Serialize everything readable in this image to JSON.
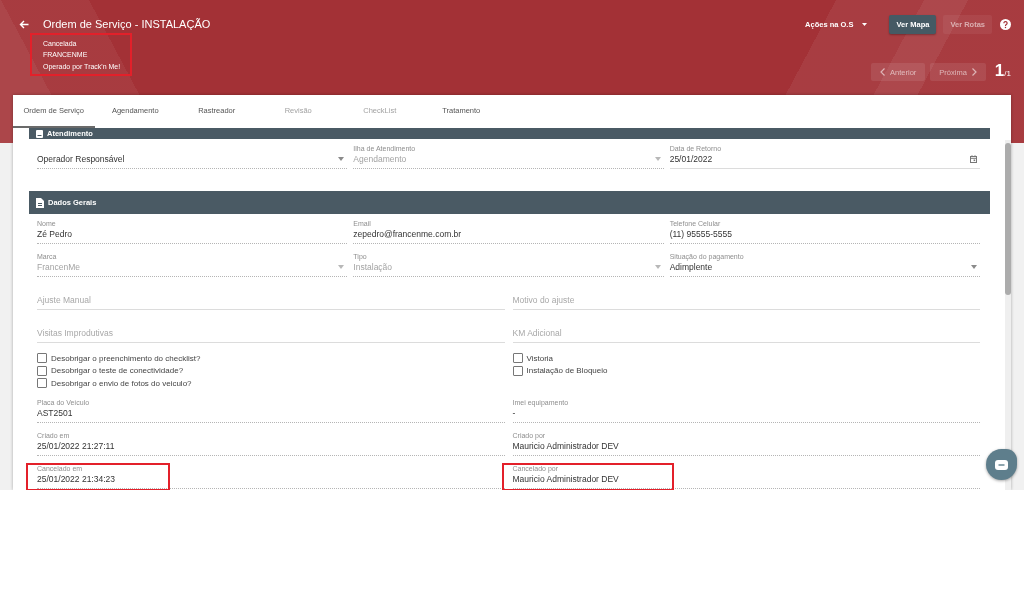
{
  "header": {
    "title": "Ordem de Serviço - INSTALAÇÃO",
    "subtitle": [
      "Cancelada",
      "FRANCENME",
      "Operado por Track'n Me!"
    ],
    "subtitle_highlighted": true,
    "actions_menu": "Ações na O.S",
    "buttons": [
      {
        "label": "Ver Mapa",
        "disabled": false
      },
      {
        "label": "Ver Rotas",
        "disabled": true
      }
    ],
    "pager": {
      "previous": {
        "label": "Anterior",
        "disabled": true
      },
      "next": {
        "label": "Próxima",
        "disabled": true
      },
      "counter": "1$_{/1}$"
    }
  },
  "tabs": [
    {
      "label": "Ordem de Serviço",
      "selected": true,
      "disabled": false
    },
    {
      "label": "Agendamento",
      "selected": false,
      "disabled": false
    },
    {
      "label": "Rastreador",
      "selected": false,
      "disabled": false
    },
    {
      "label": "Revisão",
      "selected": false,
      "disabled": true
    },
    {
      "label": "CheckList",
      "selected": false,
      "disabled": true
    },
    {
      "label": "Tratamento",
      "selected": false,
      "disabled": false
    }
  ],
  "sections": [
    {
      "title": "Atendimento",
      "cut_off": true,
      "rows": [
        {
          "kind": "fields",
          "fields": [
            {
              "kind": "select",
              "value": "Operador Responsável",
              "disabled": false,
              "read_only": true,
              "highlighted": false
            },
            {
              "kind": "select",
              "label": "Ilha de Atendimento",
              "value": "Agendamento",
              "disabled": true,
              "read_only": true,
              "highlighted": false
            },
            {
              "kind": "date",
              "label": "Data de Retorno",
              "value": "25/01/2022",
              "disabled": false,
              "read_only": false,
              "highlighted": false
            }
          ]
        }
      ]
    },
    {
      "title": "Dados Gerais",
      "cut_off": false,
      "rows": [
        {
          "kind": "fields",
          "fields": [
            {
              "kind": "text",
              "label": "Nome",
              "value": "Zé Pedro",
              "disabled": false,
              "read_only": true,
              "highlighted": false
            },
            {
              "kind": "text",
              "label": "Email",
              "value": "zepedro@francenme.com.br",
              "disabled": false,
              "read_only": true,
              "highlighted": false
            },
            {
              "kind": "text",
              "label": "Telefone Celular",
              "value": "(11) 95555-5555",
              "disabled": false,
              "read_only": true,
              "highlighted": false
            }
          ]
        },
        {
          "kind": "fields",
          "fields": [
            {
              "kind": "select",
              "label": "Marca",
              "value": "FrancenMe",
              "disabled": true,
              "read_only": true,
              "highlighted": false
            },
            {
              "kind": "select",
              "label": "Tipo",
              "value": "Instalação",
              "disabled": true,
              "read_only": true,
              "highlighted": false
            },
            {
              "kind": "select",
              "label": "Situação do pagamento",
              "value": "Adimplente",
              "disabled": false,
              "read_only": true,
              "highlighted": false
            }
          ]
        },
        {
          "kind": "fields",
          "fields": [
            {
              "kind": "input",
              "placeholder": "Ajuste Manual",
              "highlighted": false
            },
            {
              "kind": "input",
              "placeholder": "Motivo do ajuste",
              "highlighted": false
            }
          ]
        },
        {
          "kind": "fields",
          "fields": [
            {
              "kind": "input",
              "placeholder": "Visitas Improdutivas",
              "highlighted": false
            },
            {
              "kind": "input",
              "placeholder": "KM Adicional",
              "highlighted": false
            }
          ]
        },
        {
          "kind": "checks",
          "columns": [
            [
              {
                "label": "Desobrigar o preenchimento do checklist?",
                "checked": false
              },
              {
                "label": "Desobrigar o teste de conectividade?",
                "checked": false
              },
              {
                "label": "Desobrigar o envio de fotos do veiculo?",
                "checked": false
              }
            ],
            [
              {
                "label": "Vistoria",
                "checked": false
              },
              {
                "label": "Instalação de Bloqueio",
                "checked": false
              }
            ]
          ]
        },
        {
          "kind": "fields",
          "fields": [
            {
              "kind": "text",
              "label": "Placa do Veículo",
              "value": "AST2501",
              "disabled": false,
              "read_only": true,
              "highlighted": false
            },
            {
              "kind": "text",
              "label": "Imei equipamento",
              "value": "-",
              "disabled": false,
              "read_only": true,
              "highlighted": false
            }
          ]
        },
        {
          "kind": "fields",
          "fields": [
            {
              "kind": "text",
              "label": "Criado em",
              "value": "25/01/2022 21:27:11",
              "disabled": false,
              "read_only": true,
              "highlighted": false
            },
            {
              "kind": "text",
              "label": "Criado por",
              "value": "Mauricio Administrador DEV",
              "disabled": false,
              "read_only": true,
              "highlighted": false
            }
          ]
        },
        {
          "kind": "fields",
          "fields": [
            {
              "kind": "text",
              "label": "Cancelado em",
              "value": "25/01/2022 21:34:23",
              "disabled": false,
              "read_only": true,
              "highlighted": true
            },
            {
              "kind": "text",
              "label": "Cancelado por",
              "value": "Mauricio Administrador DEV",
              "disabled": false,
              "read_only": true,
              "highlighted": true
            }
          ]
        }
      ]
    }
  ]
}
